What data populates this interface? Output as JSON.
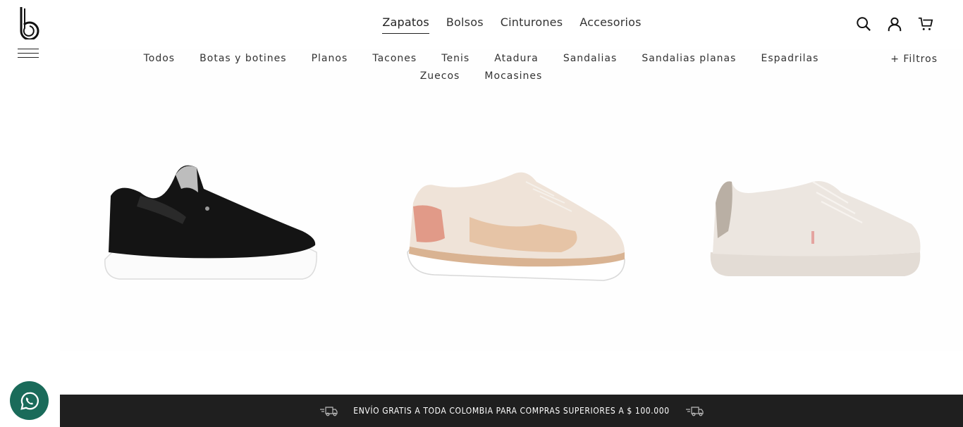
{
  "brand": {
    "logo_icon": "b-logo-icon"
  },
  "main_nav": [
    {
      "label": "Zapatos",
      "active": true
    },
    {
      "label": "Bolsos",
      "active": false
    },
    {
      "label": "Cinturones",
      "active": false
    },
    {
      "label": "Accesorios",
      "active": false
    }
  ],
  "sub_nav": [
    "Todos",
    "Botas y botines",
    "Planos",
    "Tacones",
    "Tenis",
    "Atadura",
    "Sandalias",
    "Sandalias planas",
    "Espadrilas",
    "Zuecos",
    "Mocasines"
  ],
  "filters_label": "+ Filtros",
  "header_icons": [
    "search-icon",
    "user-icon",
    "cart-icon"
  ],
  "products": [
    {
      "image": "black-slip-on-sneaker"
    },
    {
      "image": "beige-pink-running-sneaker"
    },
    {
      "image": "offwhite-lace-up-sneaker"
    }
  ],
  "banner": {
    "text": "ENVÍO GRATIS A TODA COLOMBIA PARA COMPRAS SUPERIORES A $ 100.000",
    "icon": "truck-icon"
  },
  "whatsapp": {
    "icon": "whatsapp-icon",
    "color": "#1a6b5a"
  }
}
